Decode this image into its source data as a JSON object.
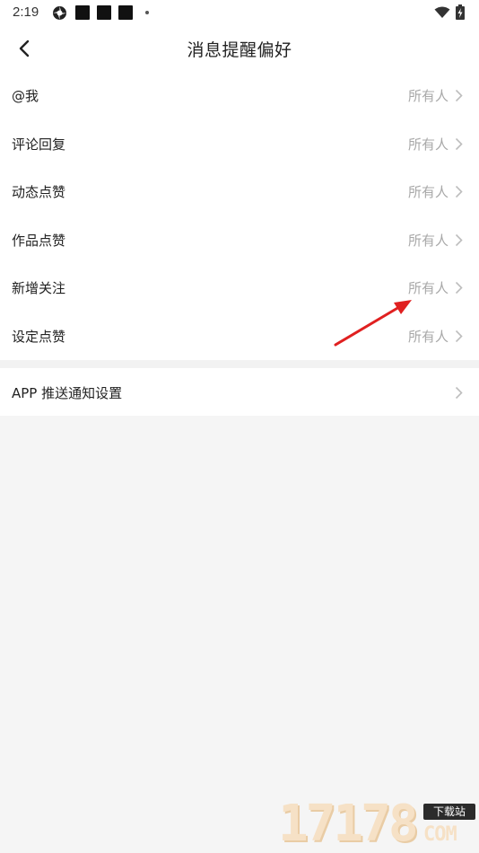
{
  "status_bar": {
    "time": "2:19"
  },
  "header": {
    "title": "消息提醒偏好"
  },
  "settings": [
    {
      "label": "@我",
      "value": "所有人"
    },
    {
      "label": "评论回复",
      "value": "所有人"
    },
    {
      "label": "动态点赞",
      "value": "所有人"
    },
    {
      "label": "作品点赞",
      "value": "所有人"
    },
    {
      "label": "新增关注",
      "value": "所有人"
    },
    {
      "label": "设定点赞",
      "value": "所有人"
    }
  ],
  "push_settings": {
    "label": "APP 推送通知设置"
  },
  "watermark": {
    "number": "17178",
    "tag": "下载站",
    "domain": "COM"
  },
  "colors": {
    "arrow": "#e02020",
    "value_text": "#a8a8a8",
    "background": "#f5f5f5"
  }
}
